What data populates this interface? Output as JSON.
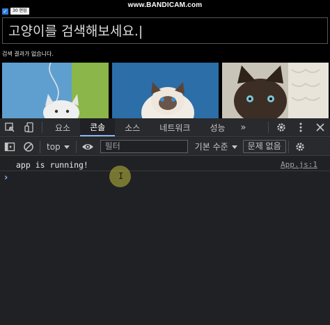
{
  "recorder": {
    "checkbox_label": "30 현업",
    "watermark": "www.BANDICAM.com"
  },
  "app": {
    "search_placeholder": "고양이를 검색해보세요.|",
    "result_text": "검색 결과가 없습니다."
  },
  "devtools": {
    "tabs": [
      {
        "label": "요소"
      },
      {
        "label": "콘솔"
      },
      {
        "label": "소스"
      },
      {
        "label": "네트워크"
      },
      {
        "label": "성능"
      }
    ],
    "more_label": "»",
    "context": "top",
    "filter_placeholder": "필터",
    "levels_label": "기본 수준",
    "issues_label": "문제 없음",
    "console": {
      "message": "app is running!",
      "source": "App.js:1",
      "prompt": "›"
    }
  },
  "colors": {
    "accent": "#8ab4f8",
    "devtools_bg": "#202124",
    "toolbar_bg": "#292a2d"
  }
}
